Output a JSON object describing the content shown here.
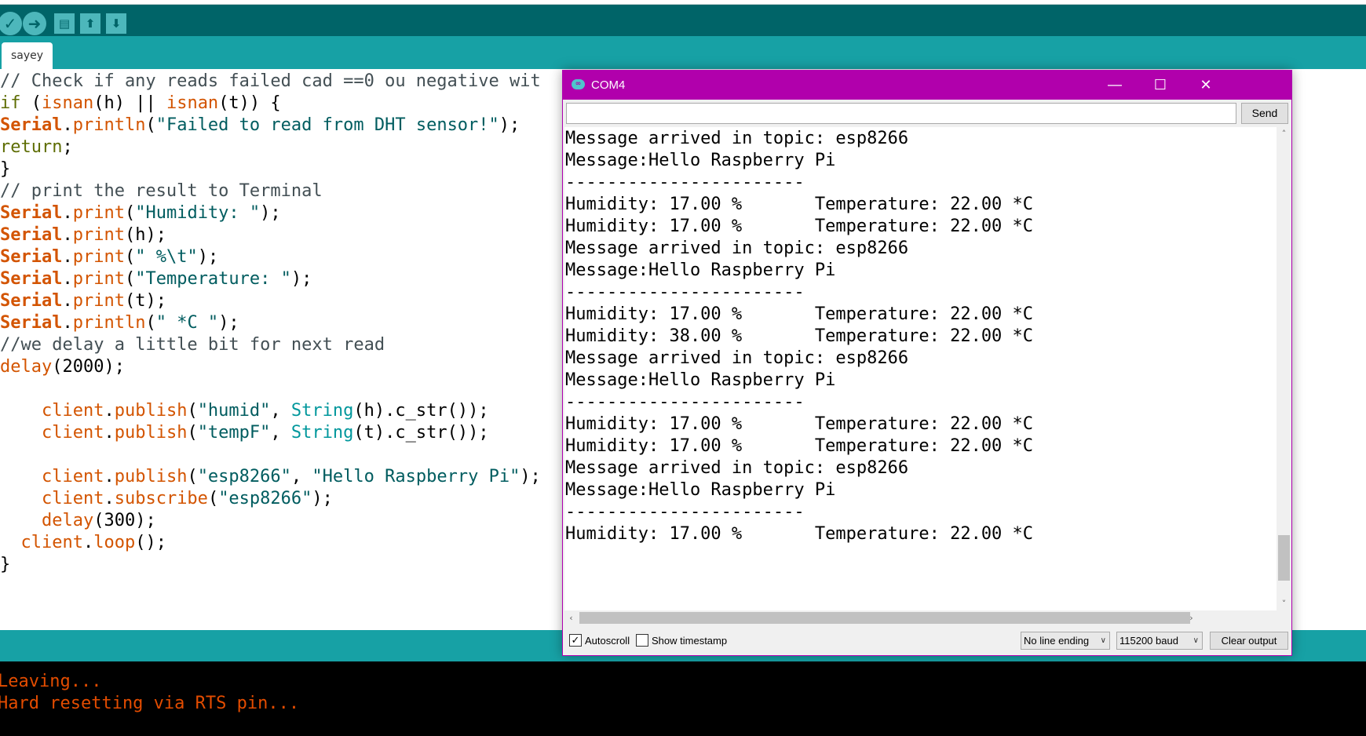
{
  "toolbar": {
    "buttons": [
      {
        "name": "verify",
        "glyph": "✓"
      },
      {
        "name": "upload",
        "glyph": "➜"
      },
      {
        "name": "new",
        "glyph": "▤"
      },
      {
        "name": "open",
        "glyph": "⬆"
      },
      {
        "name": "save",
        "glyph": "⬇"
      }
    ]
  },
  "tab": {
    "label": "sayey"
  },
  "editor": {
    "lines": [
      [
        {
          "t": "// Check if any reads failed cad ==0 ou negative wit",
          "c": "c-com"
        }
      ],
      [
        {
          "t": "if",
          "c": "c-kw"
        },
        {
          "t": " (",
          "c": ""
        },
        {
          "t": "isnan",
          "c": "c-fn"
        },
        {
          "t": "(h) || ",
          "c": ""
        },
        {
          "t": "isnan",
          "c": "c-fn"
        },
        {
          "t": "(t)) {",
          "c": ""
        }
      ],
      [
        {
          "t": "Serial",
          "c": "c-ser"
        },
        {
          "t": ".",
          "c": ""
        },
        {
          "t": "println",
          "c": "c-fn"
        },
        {
          "t": "(",
          "c": ""
        },
        {
          "t": "\"Failed to read from DHT sensor!\"",
          "c": "c-str"
        },
        {
          "t": ");",
          "c": ""
        }
      ],
      [
        {
          "t": "return",
          "c": "c-kw"
        },
        {
          "t": ";",
          "c": ""
        }
      ],
      [
        {
          "t": "}",
          "c": ""
        }
      ],
      [
        {
          "t": "// print the result to Terminal",
          "c": "c-com"
        }
      ],
      [
        {
          "t": "Serial",
          "c": "c-ser"
        },
        {
          "t": ".",
          "c": ""
        },
        {
          "t": "print",
          "c": "c-fn"
        },
        {
          "t": "(",
          "c": ""
        },
        {
          "t": "\"Humidity: \"",
          "c": "c-str"
        },
        {
          "t": ");",
          "c": ""
        }
      ],
      [
        {
          "t": "Serial",
          "c": "c-ser"
        },
        {
          "t": ".",
          "c": ""
        },
        {
          "t": "print",
          "c": "c-fn"
        },
        {
          "t": "(h);",
          "c": ""
        }
      ],
      [
        {
          "t": "Serial",
          "c": "c-ser"
        },
        {
          "t": ".",
          "c": ""
        },
        {
          "t": "print",
          "c": "c-fn"
        },
        {
          "t": "(",
          "c": ""
        },
        {
          "t": "\" %\\t\"",
          "c": "c-str"
        },
        {
          "t": ");",
          "c": ""
        }
      ],
      [
        {
          "t": "Serial",
          "c": "c-ser"
        },
        {
          "t": ".",
          "c": ""
        },
        {
          "t": "print",
          "c": "c-fn"
        },
        {
          "t": "(",
          "c": ""
        },
        {
          "t": "\"Temperature: \"",
          "c": "c-str"
        },
        {
          "t": ");",
          "c": ""
        }
      ],
      [
        {
          "t": "Serial",
          "c": "c-ser"
        },
        {
          "t": ".",
          "c": ""
        },
        {
          "t": "print",
          "c": "c-fn"
        },
        {
          "t": "(t);",
          "c": ""
        }
      ],
      [
        {
          "t": "Serial",
          "c": "c-ser"
        },
        {
          "t": ".",
          "c": ""
        },
        {
          "t": "println",
          "c": "c-fn"
        },
        {
          "t": "(",
          "c": ""
        },
        {
          "t": "\" *C \"",
          "c": "c-str"
        },
        {
          "t": ");",
          "c": ""
        }
      ],
      [
        {
          "t": "//we delay a little bit for next read",
          "c": "c-com"
        }
      ],
      [
        {
          "t": "delay",
          "c": "c-fn"
        },
        {
          "t": "(2000);",
          "c": ""
        }
      ],
      [],
      [
        {
          "t": "    ",
          "c": ""
        },
        {
          "t": "client",
          "c": "c-fn"
        },
        {
          "t": ".",
          "c": ""
        },
        {
          "t": "publish",
          "c": "c-fn"
        },
        {
          "t": "(",
          "c": ""
        },
        {
          "t": "\"humid\"",
          "c": "c-str"
        },
        {
          "t": ", ",
          "c": ""
        },
        {
          "t": "String",
          "c": "c-cls"
        },
        {
          "t": "(h).c_str());",
          "c": ""
        }
      ],
      [
        {
          "t": "    ",
          "c": ""
        },
        {
          "t": "client",
          "c": "c-fn"
        },
        {
          "t": ".",
          "c": ""
        },
        {
          "t": "publish",
          "c": "c-fn"
        },
        {
          "t": "(",
          "c": ""
        },
        {
          "t": "\"tempF\"",
          "c": "c-str"
        },
        {
          "t": ", ",
          "c": ""
        },
        {
          "t": "String",
          "c": "c-cls"
        },
        {
          "t": "(t).c_str());",
          "c": ""
        }
      ],
      [],
      [
        {
          "t": "    ",
          "c": ""
        },
        {
          "t": "client",
          "c": "c-fn"
        },
        {
          "t": ".",
          "c": ""
        },
        {
          "t": "publish",
          "c": "c-fn"
        },
        {
          "t": "(",
          "c": ""
        },
        {
          "t": "\"esp8266\"",
          "c": "c-str"
        },
        {
          "t": ", ",
          "c": ""
        },
        {
          "t": "\"Hello Raspberry Pi\"",
          "c": "c-str"
        },
        {
          "t": ");",
          "c": ""
        }
      ],
      [
        {
          "t": "    ",
          "c": ""
        },
        {
          "t": "client",
          "c": "c-fn"
        },
        {
          "t": ".",
          "c": ""
        },
        {
          "t": "subscribe",
          "c": "c-fn"
        },
        {
          "t": "(",
          "c": ""
        },
        {
          "t": "\"esp8266\"",
          "c": "c-str"
        },
        {
          "t": ");",
          "c": ""
        }
      ],
      [
        {
          "t": "    ",
          "c": ""
        },
        {
          "t": "delay",
          "c": "c-fn"
        },
        {
          "t": "(300);",
          "c": ""
        }
      ],
      [
        {
          "t": "  ",
          "c": ""
        },
        {
          "t": "client",
          "c": "c-fn"
        },
        {
          "t": ".",
          "c": ""
        },
        {
          "t": "loop",
          "c": "c-fn"
        },
        {
          "t": "();",
          "c": ""
        }
      ],
      [
        {
          "t": "}",
          "c": ""
        }
      ]
    ]
  },
  "console": {
    "lines": [
      "Leaving...",
      "Hard resetting via RTS pin..."
    ]
  },
  "serial_monitor": {
    "title": "COM4",
    "icon_text": "∞",
    "input_value": "",
    "send_label": "Send",
    "output": [
      "Message arrived in topic: esp8266",
      "Message:Hello Raspberry Pi",
      "-----------------------",
      "Humidity: 17.00 %\tTemperature: 22.00 *C",
      "Humidity: 17.00 %\tTemperature: 22.00 *C",
      "Message arrived in topic: esp8266",
      "Message:Hello Raspberry Pi",
      "-----------------------",
      "Humidity: 17.00 %\tTemperature: 22.00 *C",
      "Humidity: 38.00 %\tTemperature: 22.00 *C",
      "Message arrived in topic: esp8266",
      "Message:Hello Raspberry Pi",
      "-----------------------",
      "Humidity: 17.00 %\tTemperature: 22.00 *C",
      "Humidity: 17.00 %\tTemperature: 22.00 *C",
      "Message arrived in topic: esp8266",
      "Message:Hello Raspberry Pi",
      "-----------------------",
      "Humidity: 17.00 %\tTemperature: 22.00 *C"
    ],
    "autoscroll": {
      "label": "Autoscroll",
      "checked": true
    },
    "timestamp": {
      "label": "Show timestamp",
      "checked": false
    },
    "line_ending": "No line ending",
    "baud": "115200 baud",
    "clear_label": "Clear output"
  },
  "colors": {
    "toolbar": "#006468",
    "tabbar": "#17a1a5",
    "serial_title": "#b100ac",
    "console_text": "#e34c00"
  }
}
